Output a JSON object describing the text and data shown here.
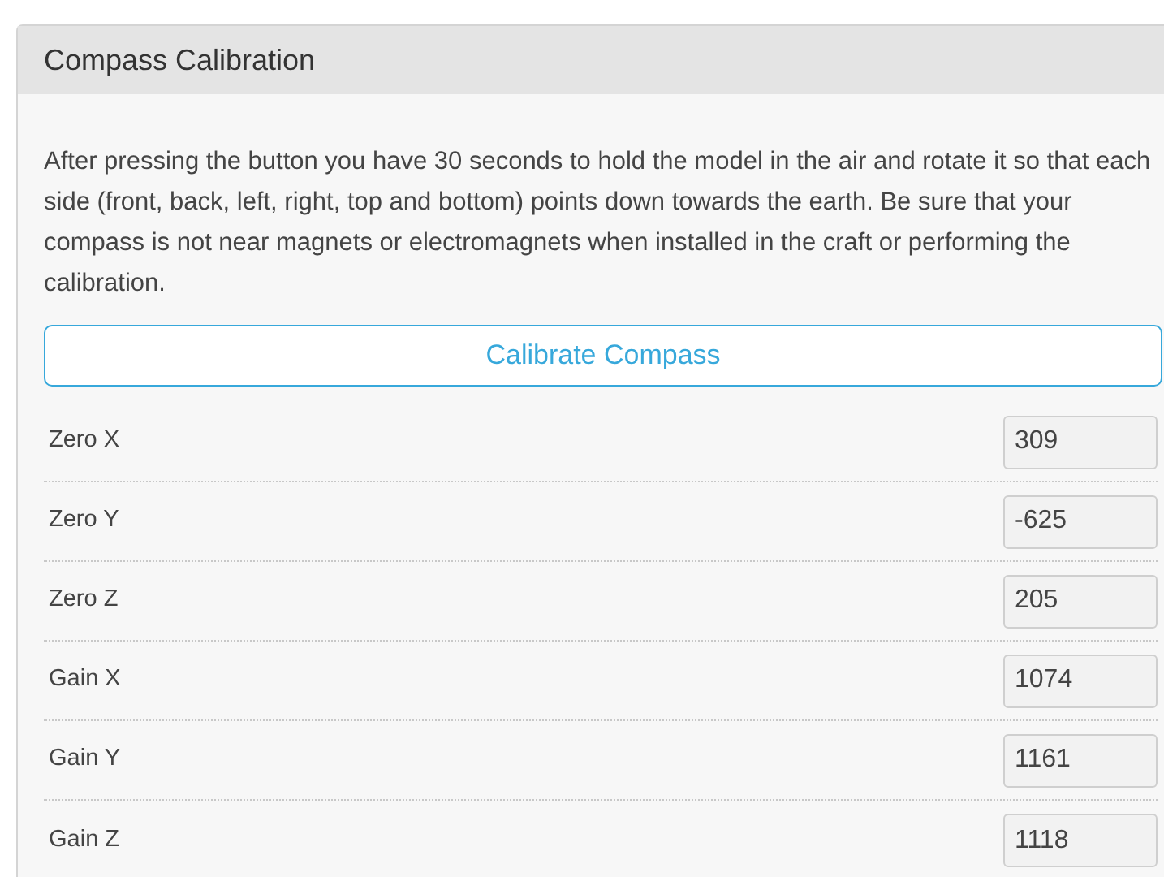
{
  "panel": {
    "title": "Compass Calibration"
  },
  "description": "After pressing the button you have 30 seconds to hold the model in the air and rotate it so that each side (front, back, left, right, top and bottom) points down towards the earth. Be sure that your compass is not near magnets or electromagnets when installed in the craft or performing the calibration.",
  "button": "Calibrate Compass",
  "fields": [
    {
      "label": "Zero X",
      "value": "309"
    },
    {
      "label": "Zero Y",
      "value": "-625"
    },
    {
      "label": "Zero Z",
      "value": "205"
    },
    {
      "label": "Gain X",
      "value": "1074"
    },
    {
      "label": "Gain Y",
      "value": "1161"
    },
    {
      "label": "Gain Z",
      "value": "1118"
    }
  ]
}
